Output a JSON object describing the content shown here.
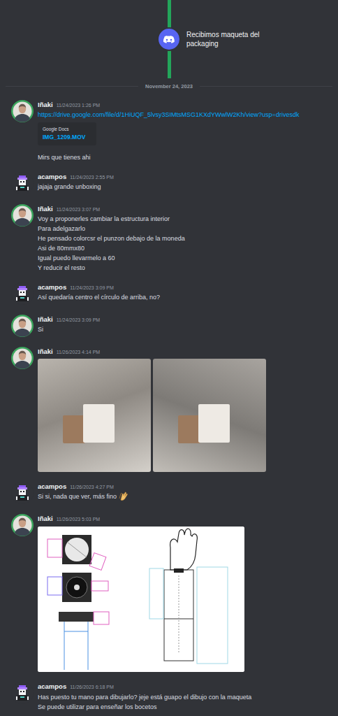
{
  "event": {
    "label": "Recibimos maqueta del packaging"
  },
  "date_divider": "November 24, 2023",
  "messages": [
    {
      "author": "Iñaki",
      "timestamp": "11/24/2023 1:26 PM",
      "content": [
        {
          "kind": "link",
          "text": "https://drive.google.com/file/d/1HiUQF_5lvsy3SIMtsMSG1KXdYWwlW2Kh/view?usp=drivesdk"
        },
        {
          "kind": "embed",
          "provider": "Google Docs",
          "title": "IMG_1209.MOV"
        },
        {
          "kind": "text",
          "lines": [
            "Mirs que tienes ahi"
          ]
        }
      ]
    },
    {
      "author": "acampos",
      "timestamp": "11/24/2023 2:55 PM",
      "content": [
        {
          "kind": "text",
          "lines": [
            "jajaja grande unboxing"
          ]
        }
      ]
    },
    {
      "author": "Iñaki",
      "timestamp": "11/24/2023 3:07 PM",
      "content": [
        {
          "kind": "text",
          "lines": [
            "Voy a proponerles cambiar la estructura interior",
            "Para adelgazarlo",
            "He pensado colorcsr el punzon debajo de la moneda",
            "Asi de 80mmx80",
            "Igual puedo llevarmelo a 60",
            "Y reducir el resto"
          ]
        }
      ]
    },
    {
      "author": "acampos",
      "timestamp": "11/24/2023 3:09 PM",
      "content": [
        {
          "kind": "text",
          "lines": [
            "Así quedaría centro el círculo de arriba, no?"
          ]
        }
      ]
    },
    {
      "author": "Iñaki",
      "timestamp": "11/24/2023 3:09 PM",
      "content": [
        {
          "kind": "text",
          "lines": [
            "Si"
          ]
        }
      ]
    },
    {
      "author": "Iñaki",
      "timestamp": "11/26/2023 4:14 PM",
      "content": [
        {
          "kind": "photo"
        },
        {
          "kind": "photo"
        }
      ]
    },
    {
      "author": "acampos",
      "timestamp": "11/26/2023 4:27 PM",
      "content": [
        {
          "kind": "text-emoji",
          "lines": [
            "Si si, nada que ver, más fino"
          ]
        }
      ]
    },
    {
      "author": "Iñaki",
      "timestamp": "11/26/2023 5:03 PM",
      "content": [
        {
          "kind": "drawing"
        }
      ]
    },
    {
      "author": "acampos",
      "timestamp": "11/26/2023 6:18 PM",
      "content": [
        {
          "kind": "text",
          "lines": [
            "Has puesto tu mano para dibujarlo? jeje está guapo el dibujo con la maqueta",
            "Se puede utilizar para enseñar los bocetos"
          ]
        }
      ]
    }
  ]
}
